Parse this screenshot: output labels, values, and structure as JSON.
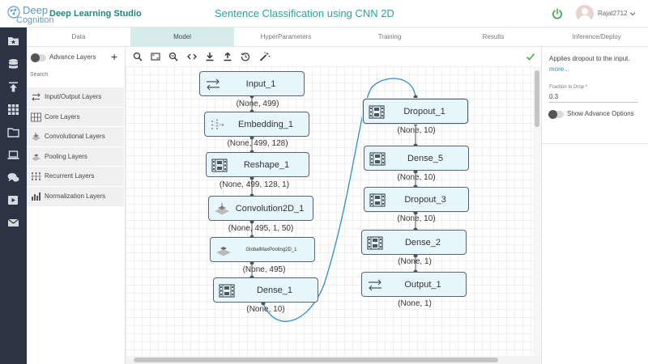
{
  "header": {
    "logo_deep": "Deep",
    "logo_cognition": "Cognition",
    "brand": "Deep Learning Studio",
    "project_title": "Sentence Classification using CNN 2D",
    "username": "Rajat2712"
  },
  "colors": {
    "teal": "#2aa3a0",
    "brand_green": "#1b8a7a",
    "nav_bg": "#2a3442",
    "active_tab": "#d6ecea",
    "node_fill": "#e6f6fb",
    "wire": "#2c8fc9",
    "check": "#4caf50"
  },
  "nav_icons": [
    "star-folder-icon",
    "database-icon",
    "upload-icon",
    "grid-icon",
    "folder-icon",
    "laptop-icon",
    "chat-icon",
    "play-icon",
    "mail-icon"
  ],
  "tabs": [
    {
      "label": "Data",
      "active": false
    },
    {
      "label": "Model",
      "active": true
    },
    {
      "label": "HyperParameters",
      "active": false
    },
    {
      "label": "Training",
      "active": false
    },
    {
      "label": "Results",
      "active": false
    },
    {
      "label": "Inference/Deploy",
      "active": false
    }
  ],
  "layer_panel": {
    "advance_label": "Advance Layers",
    "search_placeholder": "Search",
    "categories": [
      {
        "label": "Input/Output Layers",
        "icon": "arrows-icon"
      },
      {
        "label": "Core Layers",
        "icon": "core-grid-icon"
      },
      {
        "label": "Convolutional Layers",
        "icon": "conv-icon"
      },
      {
        "label": "Pooling Layers",
        "icon": "pooling-icon"
      },
      {
        "label": "Recurrent Layers",
        "icon": "recurrent-icon"
      },
      {
        "label": "Normalization Layers",
        "icon": "bar-chart-icon"
      }
    ]
  },
  "toolbar": [
    "zoom-in-icon",
    "fit-screen-icon",
    "zoom-out-icon",
    "code-icon",
    "download-icon",
    "upload-icon",
    "history-icon",
    "magic-wand-icon"
  ],
  "model": {
    "nodes": [
      {
        "id": "input_1",
        "label": "Input_1",
        "icon": "arrows",
        "shape": "(None, 499)",
        "selected": false
      },
      {
        "id": "embedding_1",
        "label": "Embedding_1",
        "icon": "embed",
        "shape": "(None, 499, 128)",
        "selected": false
      },
      {
        "id": "reshape_1",
        "label": "Reshape_1",
        "icon": "film",
        "shape": "(None, 499, 128, 1)",
        "selected": false
      },
      {
        "id": "conv2d_1",
        "label": "Convolution2D_1",
        "icon": "conv",
        "shape": "(None, 495, 1, 50)",
        "selected": false
      },
      {
        "id": "gmp2d_1",
        "label": "GlobalMaxPooling2D_1",
        "icon": "conv",
        "shape": "(None, 495)",
        "selected": false
      },
      {
        "id": "dense_1",
        "label": "Dense_1",
        "icon": "film",
        "shape": "(None, 10)",
        "selected": false
      },
      {
        "id": "dropout_1",
        "label": "Dropout_1",
        "icon": "film",
        "shape": "(None, 10)",
        "selected": true
      },
      {
        "id": "dense_5",
        "label": "Dense_5",
        "icon": "film",
        "shape": "(None, 10)",
        "selected": false
      },
      {
        "id": "dropout_3",
        "label": "Dropout_3",
        "icon": "film",
        "shape": "(None, 10)",
        "selected": false
      },
      {
        "id": "dense_2",
        "label": "Dense_2",
        "icon": "film",
        "shape": "(None, 1)",
        "selected": false
      },
      {
        "id": "output_1",
        "label": "Output_1",
        "icon": "arrows",
        "shape": "(None, 1)",
        "selected": false
      }
    ]
  },
  "properties": {
    "description": "Applies dropout to the input.",
    "more_link": "more...",
    "param_label": "Fraction to Drop *",
    "param_value": "0.3",
    "show_advance_label": "Show Advance Options"
  }
}
